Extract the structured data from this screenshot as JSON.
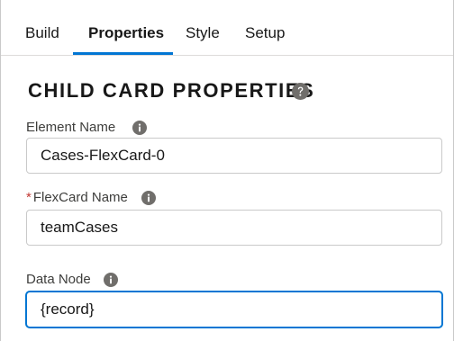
{
  "tabs": [
    {
      "label": "Build",
      "active": false
    },
    {
      "label": "Properties",
      "active": true
    },
    {
      "label": "Style",
      "active": false
    },
    {
      "label": "Setup",
      "active": false
    }
  ],
  "section": {
    "title": "CHILD CARD PROPERTIES",
    "help_icon": "question-circle-icon"
  },
  "fields": {
    "element_name": {
      "label": "Element Name",
      "value": "Cases-FlexCard-0",
      "required": false,
      "info_icon": "info-icon"
    },
    "flexcard_name": {
      "label": "FlexCard Name",
      "required_marker": "*",
      "value": "teamCases",
      "required": true,
      "info_icon": "info-icon"
    },
    "data_node": {
      "label": "Data Node",
      "value": "{record}",
      "required": false,
      "focused": true,
      "info_icon": "info-icon"
    }
  },
  "colors": {
    "accent": "#0176d3",
    "required": "#c23934",
    "icon": "#706e6b",
    "border": "#c9c9c9"
  }
}
